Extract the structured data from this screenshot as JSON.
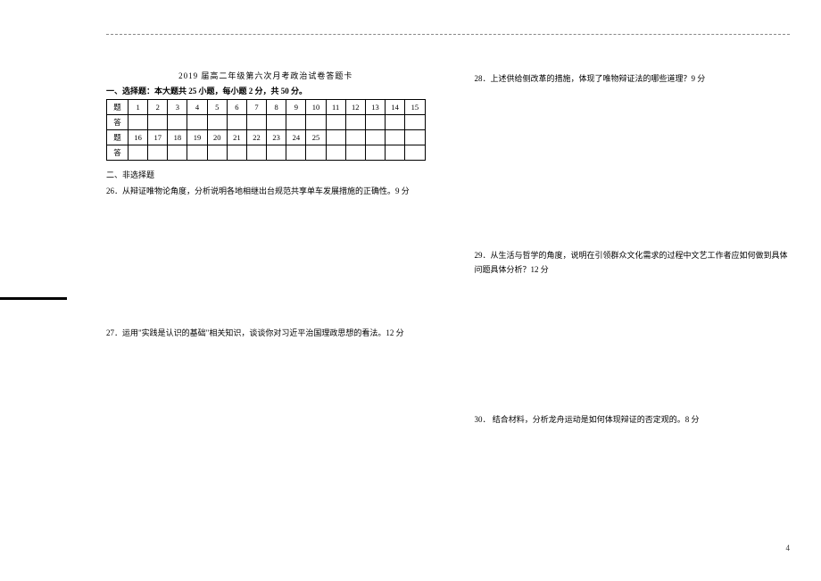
{
  "title": "2019 届高二年级第六次月考政治试卷答题卡",
  "sectionA": {
    "heading": "一、选择题：本大题共 25 小题，每小题 2 分，共 50 分。",
    "rowLabelQ": "题",
    "rowLabelA": "答",
    "row1": [
      "1",
      "2",
      "3",
      "4",
      "5",
      "6",
      "7",
      "8",
      "9",
      "10",
      "11",
      "12",
      "13",
      "14",
      "15"
    ],
    "row2": [
      "16",
      "17",
      "18",
      "19",
      "20",
      "21",
      "22",
      "23",
      "24",
      "25",
      "",
      "",
      "",
      "",
      ""
    ]
  },
  "sectionB": {
    "heading": "二、非选择题"
  },
  "q26": "26．从辩证唯物论角度，分析说明各地相继出台规范共享单车发展措施的正确性。9 分",
  "q27": "27．运用\"实践是认识的基础\"相关知识，谈谈你对习近平治国理政思想的看法。12 分",
  "q28": "28．上述供给侧改革的措施，体现了唯物辩证法的哪些道理？9 分",
  "q29": "29．从生活与哲学的角度，说明在引领群众文化需求的过程中文艺工作者应如何做到具体问题具体分析？12 分",
  "q30": "30．  结合材料，分析龙舟运动是如何体现辩证的否定观的。8 分",
  "pageNum": "4"
}
